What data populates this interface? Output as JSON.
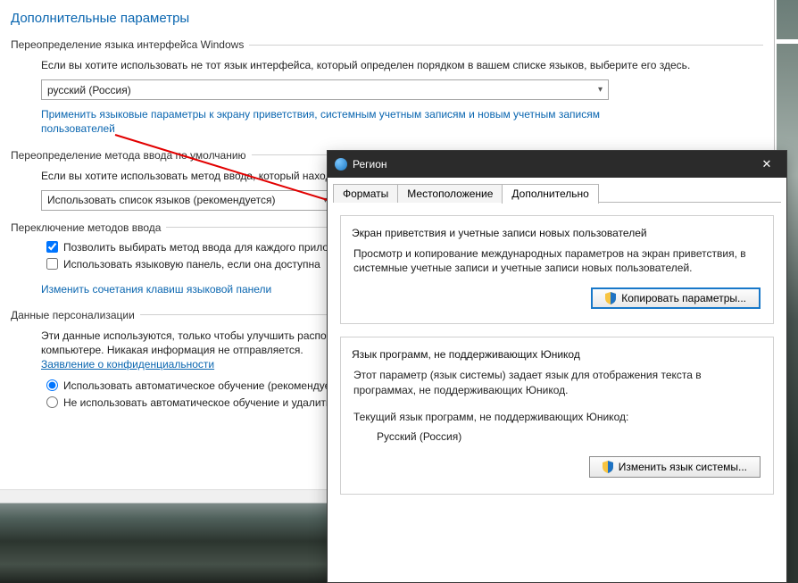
{
  "page": {
    "heading": "Дополнительные параметры"
  },
  "override_lang": {
    "title": "Переопределение языка интерфейса Windows",
    "desc": "Если вы хотите использовать не тот язык интерфейса, который определен порядком в вашем списке языков, выберите его здесь.",
    "value": "русский (Россия)",
    "apply_link": "Применить языковые параметры к экрану приветствия, системным учетным записям и новым учетным записям пользователей"
  },
  "override_input": {
    "title": "Переопределение метода ввода по умолчанию",
    "desc": "Если вы хотите использовать метод ввода, который находится на первом месте в списке языков, выберите его здесь.",
    "value": "Использовать список языков (рекомендуется)"
  },
  "switching": {
    "title": "Переключение методов ввода",
    "cb_per_app": "Позволить выбирать метод ввода для каждого приложения",
    "cb_langbar": "Использовать языковую панель, если она доступна",
    "hotkeys_link": "Изменить сочетания клавиш языковой панели"
  },
  "personalization": {
    "title": "Данные персонализации",
    "desc_prefix": "Эти данные используются, только чтобы улучшить распознавание рукописного ввода и текстовые предложения для языков без IME на этом компьютере. Никакая информация не отправляется.",
    "privacy_link": "Заявление о конфиденциальности",
    "radio_auto": "Использовать автоматическое обучение (рекомендуется)",
    "radio_no_auto": "Не использовать автоматическое обучение и удалить все ранее собранные данные"
  },
  "region_dialog": {
    "title": "Регион",
    "tabs": {
      "formats": "Форматы",
      "location": "Местоположение",
      "advanced": "Дополнительно"
    },
    "welcome": {
      "legend": "Экран приветствия и учетные записи новых пользователей",
      "desc": "Просмотр и копирование международных параметров на экран приветствия, в системные учетные записи и учетные записи новых пользователей.",
      "button": "Копировать параметры..."
    },
    "nonunicode": {
      "legend": "Язык программ, не поддерживающих Юникод",
      "desc": "Этот параметр (язык системы) задает язык для отображения текста в программах, не поддерживающих Юникод.",
      "current_label": "Текущий язык программ, не поддерживающих Юникод:",
      "current_value": "Русский (Россия)",
      "button": "Изменить язык системы..."
    }
  }
}
